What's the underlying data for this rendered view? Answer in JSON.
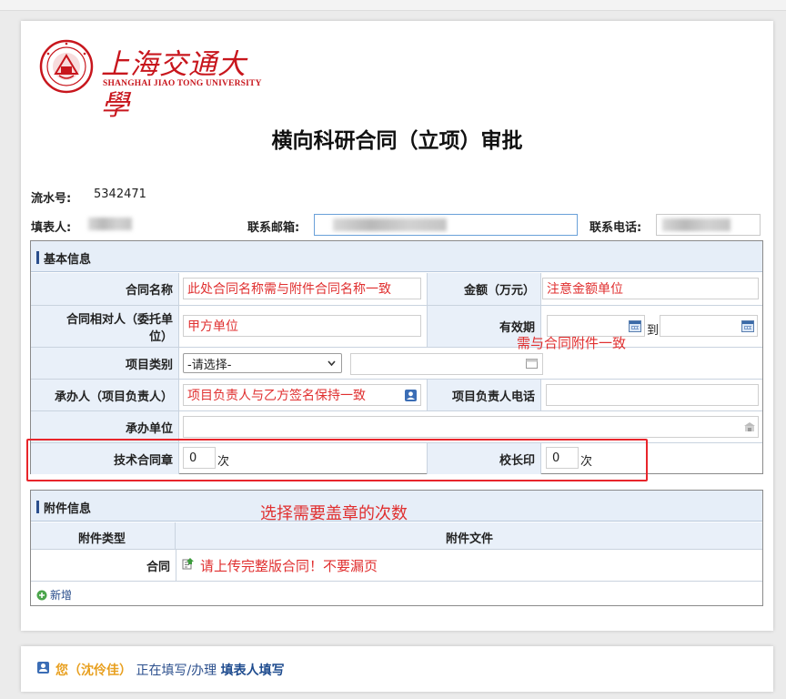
{
  "logo": {
    "cn_text": "上海交通大學",
    "en_text": "SHANGHAI JIAO TONG UNIVERSITY"
  },
  "form": {
    "title": "横向科研合同（立项）审批",
    "serial_label": "流水号:",
    "serial_value": "5342471",
    "filler_label": "填表人:",
    "email_label": "联系邮箱:",
    "phone_label": "联系电话:"
  },
  "basic": {
    "section_title": "基本信息",
    "contract_name_label": "合同名称",
    "contract_name_value": "此处合同名称需与附件合同名称一致",
    "amount_label": "金额（万元）",
    "amount_value": "注意金额单位",
    "party_label": "合同相对人（委托单位）",
    "party_value": "甲方单位",
    "validity_label": "有效期",
    "validity_to": "到",
    "validity_note": "需与合同附件一致",
    "category_label": "项目类别",
    "category_selected": "-请选择-",
    "undertaker_label": "承办人（项目负责人）",
    "undertaker_value": "项目负责人与乙方签名保持一致",
    "leader_phone_label": "项目负责人电话",
    "unit_label": "承办单位",
    "tech_seal_label": "技术合同章",
    "tech_seal_value": "0",
    "tech_seal_unit": "次",
    "president_seal_label": "校长印",
    "president_seal_value": "0",
    "president_seal_unit": "次"
  },
  "attachments": {
    "section_title": "附件信息",
    "annotation": "选择需要盖章的次数",
    "col_type": "附件类型",
    "col_file": "附件文件",
    "row_type": "合同",
    "row_note": "请上传完整版合同！不要漏页",
    "add_label": "新增"
  },
  "footer": {
    "user": "您（沈伶佳）",
    "middle": "正在填写/办理",
    "role": "填表人填写"
  },
  "colors": {
    "accent_red": "#e03030",
    "logo_red": "#c8161d",
    "label_bg": "#e9f0f9",
    "header_bar": "#2a4e8c"
  }
}
